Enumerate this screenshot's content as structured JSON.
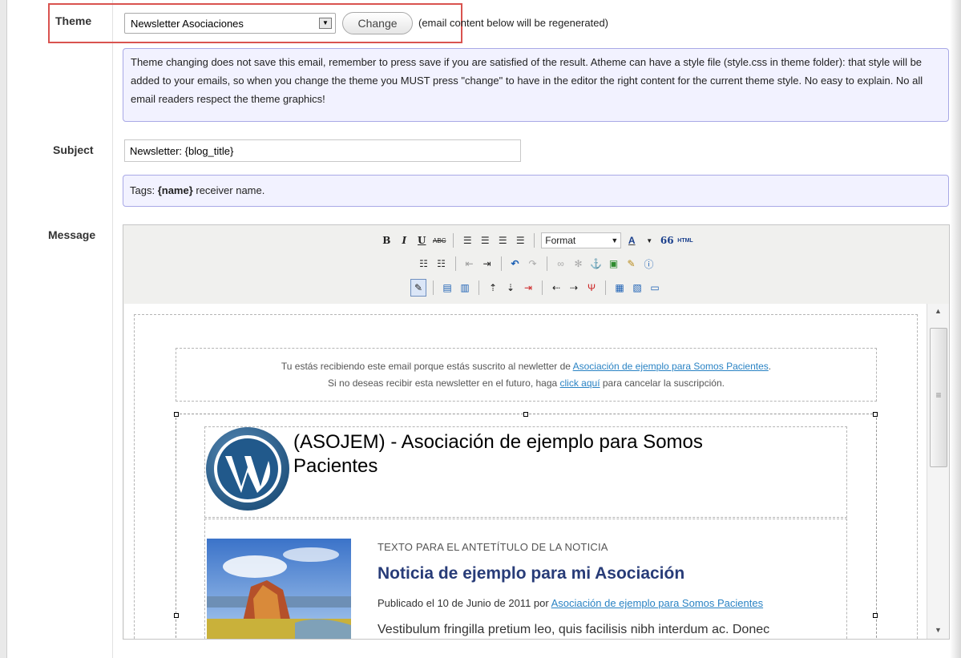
{
  "theme": {
    "label": "Theme",
    "selected": "Newsletter Asociaciones",
    "change_label": "Change",
    "note": "(email content below will be regenerated)",
    "info": "Theme changing does not save this email, remember to press save if you are satisfied of the result. Atheme can have a style file (style.css in theme folder): that style will be added to your emails, so when you change the theme you MUST press \"change\" to have in the editor the right content for the current theme style. No easy to explain. No all email readers respect the theme graphics!"
  },
  "subject": {
    "label": "Subject",
    "value": "Newsletter: {blog_title}",
    "tags_prefix": "Tags: ",
    "tags_code": "{name}",
    "tags_suffix": " receiver name."
  },
  "message": {
    "label": "Message",
    "toolbar": {
      "bold": "B",
      "italic": "I",
      "underline": "U",
      "strike": "ABC",
      "format": "Format",
      "font_color": "A",
      "quote": "66",
      "html": "HTML"
    }
  },
  "email": {
    "pre_header_line1": "Tu estás recibiendo este email porque estás suscrito al newletter de ",
    "pre_header_link1": "Asociación de ejemplo para Somos Pacientes",
    "pre_header_line1_end": ".",
    "pre_header_line2": "Si no deseas recibir esta newsletter en el futuro, haga ",
    "pre_header_link2": "click aquí",
    "pre_header_line2_end": " para cancelar la suscripción.",
    "header_title": "(ASOJEM) - Asociación de ejemplo para Somos Pacientes",
    "news": {
      "kicker": "TEXTO PARA EL ANTETÍTULO DE LA NOTICIA",
      "title": "Noticia de ejemplo para mi Asociación",
      "meta_prefix": "Publicado el 10 de Junio de 2011 por ",
      "meta_link": "Asociación de ejemplo para Somos Pacientes",
      "body": "Vestibulum fringilla pretium leo, quis facilisis nibh interdum ac. Donec"
    }
  },
  "colors": {
    "highlight": "#d9534f",
    "note_bg": "#f2f2ff",
    "note_border": "#a9a9e6",
    "link": "#2a83c4",
    "news_title": "#283c78"
  }
}
